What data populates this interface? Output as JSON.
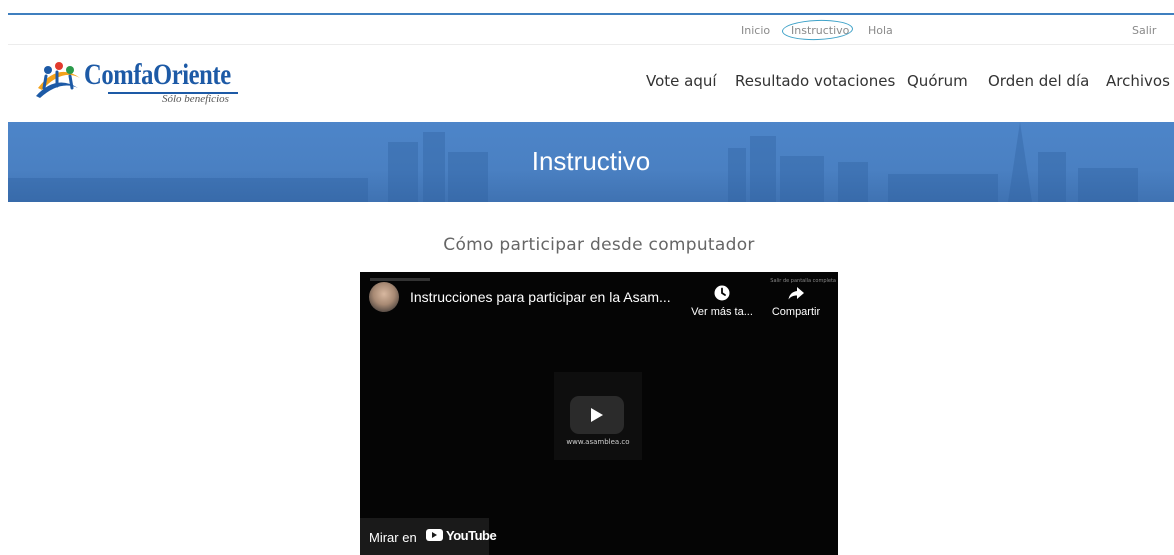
{
  "topbar": {
    "links": {
      "inicio": "Inicio",
      "instructivo": "Instructivo",
      "hola": "Hola",
      "salir": "Salir"
    }
  },
  "logo": {
    "wordmark": "ComfaOriente",
    "tagline": "Sólo beneficios"
  },
  "nav": {
    "vote": "Vote aquí",
    "results": "Resultado votaciones",
    "quorum": "Quórum",
    "orden": "Orden del día",
    "archivos": "Archivos"
  },
  "hero": {
    "title": "Instructivo"
  },
  "section": {
    "title": "Cómo participar desde computador"
  },
  "video": {
    "title": "Instrucciones para participar en la Asam...",
    "watch_later": "Ver más ta...",
    "share": "Compartir",
    "site_caption": "www.asamblea.co",
    "watch_on": "Mirar en",
    "youtube": "YouTube",
    "fullscreen_tip": "Salir de pantalla completa"
  },
  "colors": {
    "accent": "#3f7fbf",
    "hero_bg": "#4a80c2",
    "logo_blue": "#1d5aa6",
    "video_bg": "#050505"
  }
}
